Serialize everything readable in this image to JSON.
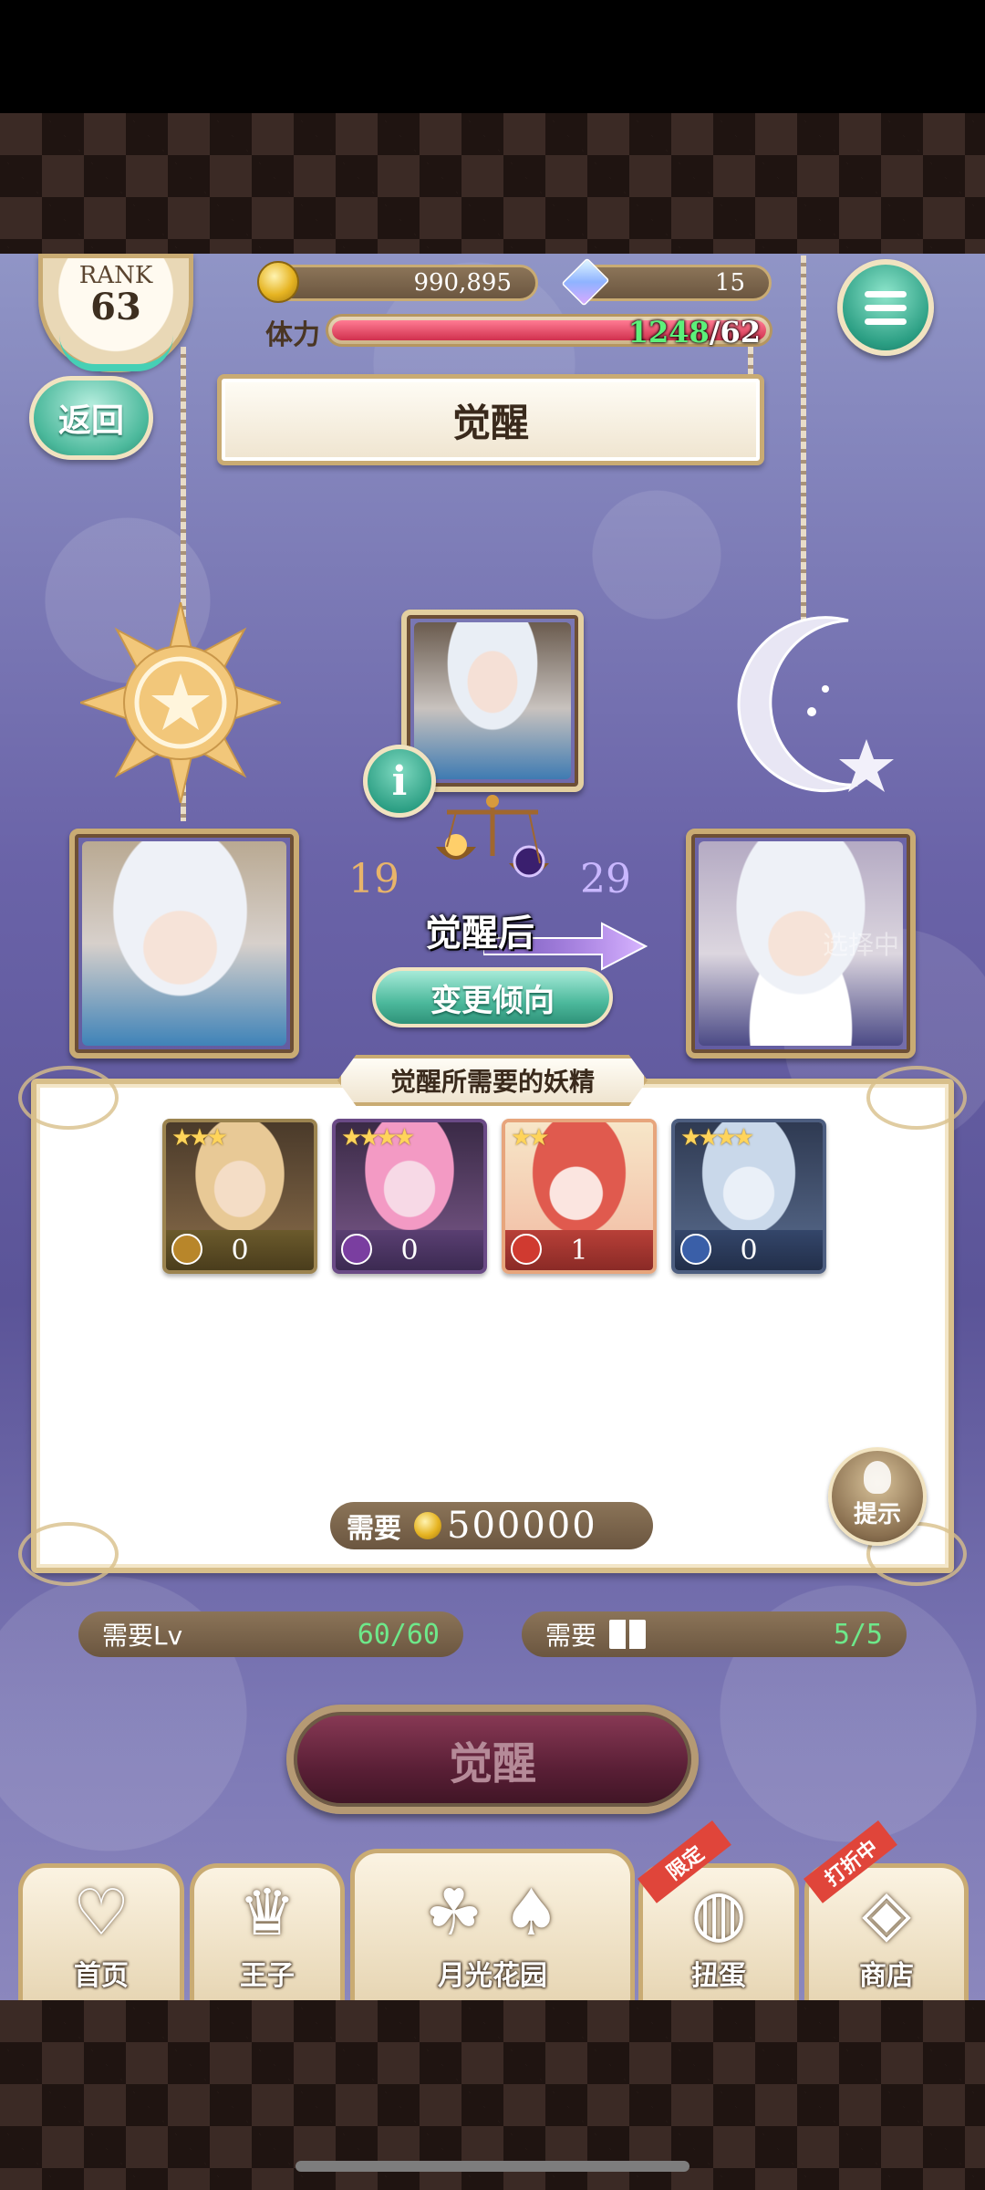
{
  "hud": {
    "rank_label": "RANK",
    "rank_value": "63",
    "gold": "990,895",
    "gems": "15",
    "stamina_label": "体力",
    "stamina_current": "1248",
    "stamina_max": "/62",
    "stamina_fill": 1.0
  },
  "header": {
    "back_label": "返回",
    "title": "觉醒"
  },
  "awakening": {
    "level_before": "19",
    "level_after": "29",
    "after_label": "觉醒后",
    "change_tendency_label": "变更倾向",
    "selecting_text": "选择中"
  },
  "fairies": {
    "header": "觉醒所需要的妖精",
    "items": [
      {
        "count": "0",
        "stars": "★★★",
        "color": "#b8862a"
      },
      {
        "count": "0",
        "stars": "★★★★",
        "color": "#7a3ea0"
      },
      {
        "count": "1",
        "stars": "★★",
        "color": "#d03a30"
      },
      {
        "count": "0",
        "stars": "★★★★",
        "color": "#3a5fa8"
      }
    ],
    "cost_label": "需要",
    "cost_value": "500000",
    "hint_label": "提示"
  },
  "requirements": {
    "level_label": "需要Lv",
    "level_value": "60/60",
    "book_label": "需要",
    "book_value": "5/5"
  },
  "awaken_button_label": "觉醒",
  "nav": {
    "home": "首页",
    "prince": "王子",
    "garden": "月光花园",
    "gacha": "扭蛋",
    "gacha_ribbon": "限定",
    "shop": "商店",
    "shop_ribbon": "打折中"
  },
  "icons": {
    "menu": "hamburger-icon",
    "info": "info-icon",
    "hint": "lightbulb-icon",
    "home": "heart-icon",
    "prince": "crown-icon",
    "gacha": "egg-icon",
    "shop": "gem-icon"
  }
}
